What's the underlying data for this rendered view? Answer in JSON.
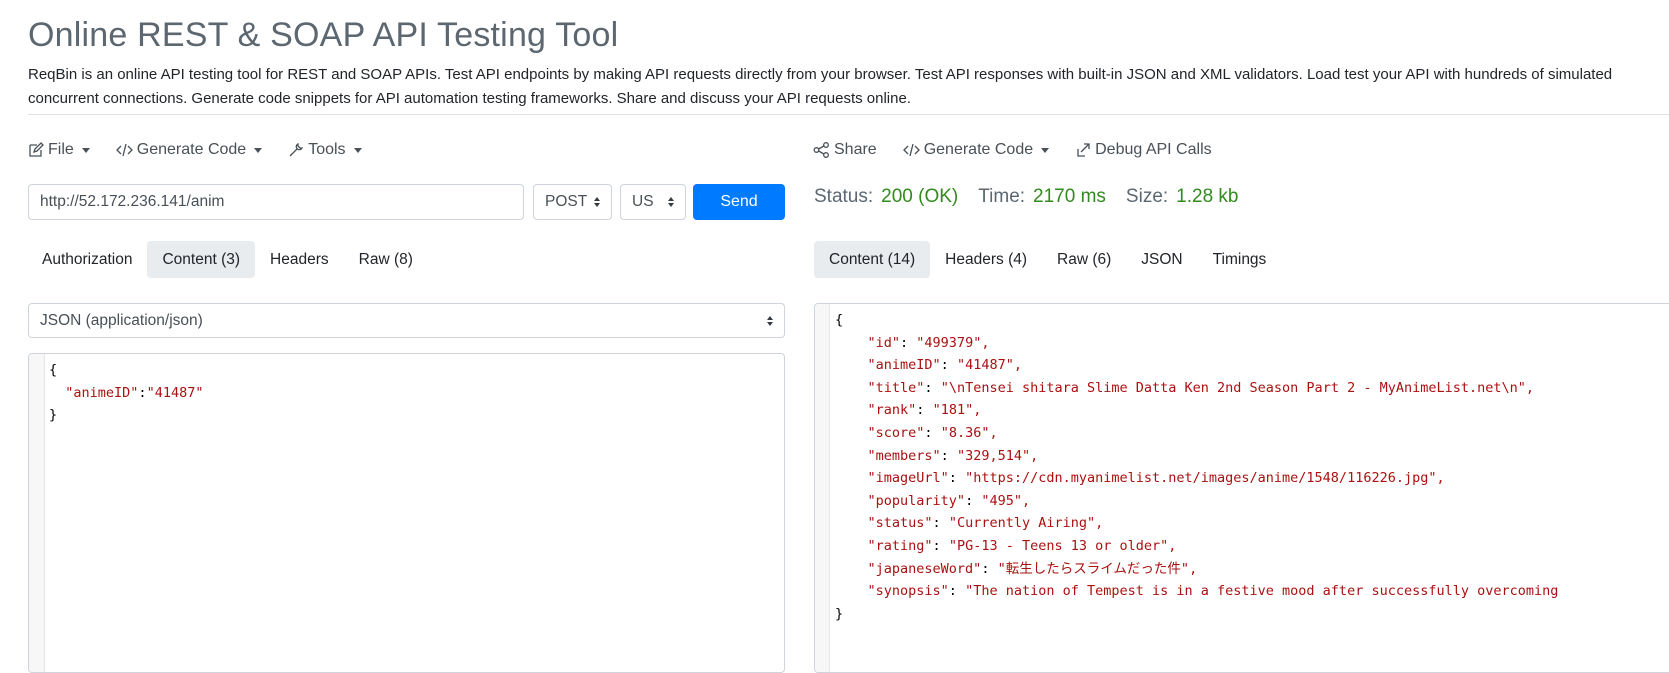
{
  "header": {
    "title": "Online REST & SOAP API Testing Tool",
    "description": "ReqBin is an online API testing tool for REST and SOAP APIs. Test API endpoints by making API requests directly from your browser. Test API responses with built-in JSON and XML validators. Load test your API with hundreds of simulated concurrent connections. Generate code snippets for API automation testing frameworks. Share and discuss your API requests online."
  },
  "request": {
    "toolbar": {
      "file": "File",
      "generate_code": "Generate Code",
      "tools": "Tools"
    },
    "url": "http://52.172.236.141/anim",
    "method": "POST",
    "region": "US",
    "send_label": "Send",
    "tabs": [
      {
        "label": "Authorization",
        "active": false
      },
      {
        "label": "Content (3)",
        "active": true
      },
      {
        "label": "Headers",
        "active": false
      },
      {
        "label": "Raw (8)",
        "active": false
      }
    ],
    "content_type": "JSON (application/json)",
    "body": {
      "open": "{",
      "key": "\"animeID\"",
      "sep": ":",
      "value": "\"41487\"",
      "close": "}"
    }
  },
  "response": {
    "toolbar": {
      "share": "Share",
      "generate_code": "Generate Code",
      "debug": "Debug API Calls"
    },
    "status": {
      "status_label": "Status:",
      "status_value": "200 (OK)",
      "time_label": "Time:",
      "time_value": "2170 ms",
      "size_label": "Size:",
      "size_value": "1.28 kb"
    },
    "tabs": [
      {
        "label": "Content (14)",
        "active": true
      },
      {
        "label": "Headers (4)",
        "active": false
      },
      {
        "label": "Raw (6)",
        "active": false
      },
      {
        "label": "JSON",
        "active": false
      },
      {
        "label": "Timings",
        "active": false
      }
    ],
    "body": {
      "open": "{",
      "close": "}",
      "fields": [
        {
          "key": "\"id\"",
          "value": "\"499379\","
        },
        {
          "key": "\"animeID\"",
          "value": "\"41487\","
        },
        {
          "key": "\"title\"",
          "value": "\"\\nTensei shitara Slime Datta Ken 2nd Season Part 2 - MyAnimeList.net\\n\","
        },
        {
          "key": "\"rank\"",
          "value": "\"181\","
        },
        {
          "key": "\"score\"",
          "value": "\"8.36\","
        },
        {
          "key": "\"members\"",
          "value": "\"329,514\","
        },
        {
          "key": "\"imageUrl\"",
          "value": "\"https://cdn.myanimelist.net/images/anime/1548/116226.jpg\","
        },
        {
          "key": "\"popularity\"",
          "value": "\"495\","
        },
        {
          "key": "\"status\"",
          "value": "\"Currently Airing\","
        },
        {
          "key": "\"rating\"",
          "value": "\"PG-13 - Teens 13 or older\","
        },
        {
          "key": "\"japaneseWord\"",
          "value": "\"転生したらスライムだった件\","
        },
        {
          "key": "\"synopsis\"",
          "value": "\"The nation of Tempest is in a festive mood after successfully overcoming"
        }
      ]
    }
  },
  "colors": {
    "accent": "#007bff",
    "success": "#338a1f",
    "muted": "#5c6770",
    "json_string": "#aa1111"
  },
  "icons": [
    "file-edit-icon",
    "code-icon",
    "tools-icon",
    "share-icon",
    "external-link-icon"
  ]
}
